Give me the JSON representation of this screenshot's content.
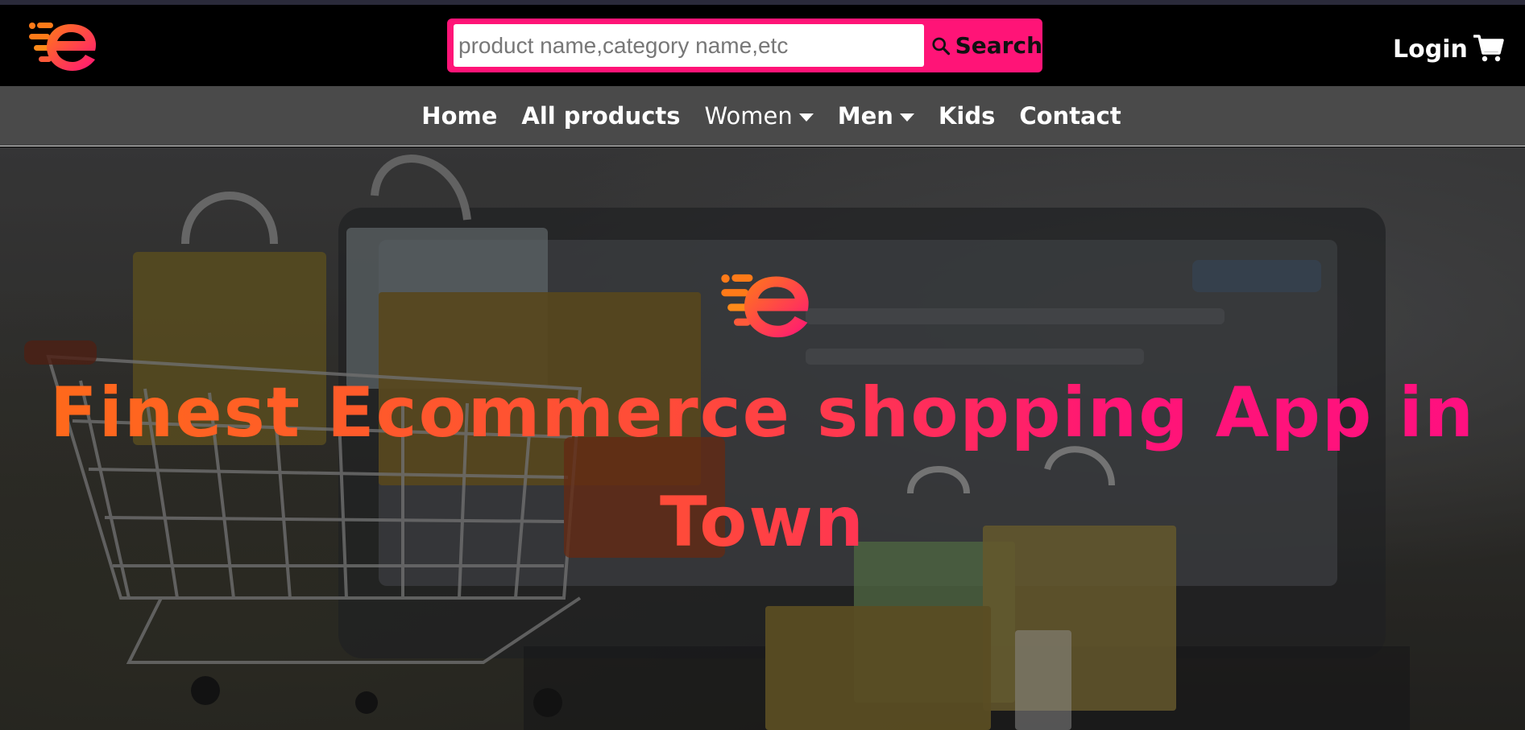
{
  "header": {
    "logo_icon": "ecommerce-e-logo",
    "search": {
      "placeholder": "product name,category name,etc",
      "value": "",
      "button_label": "Search",
      "icon": "search-icon"
    },
    "login_label": "Login",
    "cart_icon": "cart-icon"
  },
  "nav": {
    "items": [
      {
        "label": "Home",
        "dropdown": false
      },
      {
        "label": "All products",
        "dropdown": false
      },
      {
        "label": "Women",
        "dropdown": true
      },
      {
        "label": "Men",
        "dropdown": true
      },
      {
        "label": "Kids",
        "dropdown": false
      },
      {
        "label": "Contact",
        "dropdown": false
      }
    ]
  },
  "hero": {
    "logo_icon": "ecommerce-e-logo",
    "title": "Finest Ecommerce shopping App in Town"
  },
  "colors": {
    "brand_pink": "#ff1477",
    "brand_orange": "#ff6a1a",
    "nav_bg": "#4a4a4a",
    "header_bg": "#000000"
  }
}
